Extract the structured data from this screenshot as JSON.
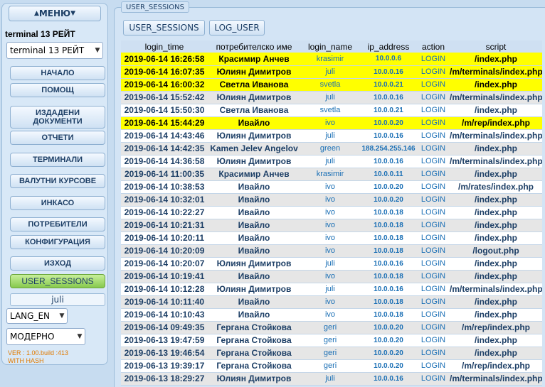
{
  "sidebar": {
    "menu_label": "МЕНЮ",
    "terminal_label": "terminal 13 РЕЙТ",
    "terminal_select": "terminal 13 РЕЙТ",
    "nav": [
      {
        "label": "НАЧАЛО"
      },
      {
        "label": "ПОМОЩ"
      },
      {
        "label": "ИЗДАДЕНИ ДОКУМЕНТИ"
      },
      {
        "label": "ОТЧЕТИ"
      },
      {
        "label": "ТЕРМИНАЛИ"
      },
      {
        "label": "ВАЛУТНИ КУРСОВЕ"
      },
      {
        "label": "ИНКАСО"
      },
      {
        "label": "ПОТРЕБИТЕЛИ"
      },
      {
        "label": "КОНФИГУРАЦИЯ"
      },
      {
        "label": "ИЗХОД"
      },
      {
        "label": "USER_SESSIONS"
      }
    ],
    "user": "juli",
    "lang": "LANG_EN",
    "theme": "МОДЕРНО",
    "version_line1": "VER : 1.00.build :413",
    "version_line2": "WITH HASH"
  },
  "main": {
    "legend": "USER_SESSIONS",
    "tabs": [
      {
        "label": "USER_SESSIONS"
      },
      {
        "label": "LOG_USER"
      }
    ],
    "columns": [
      "login_time",
      "потребителско име",
      "login_name",
      "ip_address",
      "action",
      "script"
    ],
    "rows": [
      {
        "time": "2019-06-14 16:26:58",
        "user": "Красимир Анчев",
        "login": "krasimir",
        "ip": "10.0.0.6",
        "action": "LOGIN",
        "script": "/index.php",
        "highlight": true
      },
      {
        "time": "2019-06-14 16:07:35",
        "user": "Юлиян Димитров",
        "login": "juli",
        "ip": "10.0.0.16",
        "action": "LOGIN",
        "script": "/m/terminals/index.php",
        "highlight": true
      },
      {
        "time": "2019-06-14 16:00:32",
        "user": "Светла Иванова",
        "login": "svetla",
        "ip": "10.0.0.21",
        "action": "LOGIN",
        "script": "/index.php",
        "highlight": true
      },
      {
        "time": "2019-06-14 15:52:42",
        "user": "Юлиян Димитров",
        "login": "juli",
        "ip": "10.0.0.16",
        "action": "LOGIN",
        "script": "/m/terminals/index.php",
        "highlight": false
      },
      {
        "time": "2019-06-14 15:50:30",
        "user": "Светла Иванова",
        "login": "svetla",
        "ip": "10.0.0.21",
        "action": "LOGIN",
        "script": "/index.php",
        "highlight": false
      },
      {
        "time": "2019-06-14 15:44:29",
        "user": "Ивайло",
        "login": "ivo",
        "ip": "10.0.0.20",
        "action": "LOGIN",
        "script": "/m/rep/index.php",
        "highlight": true
      },
      {
        "time": "2019-06-14 14:43:46",
        "user": "Юлиян Димитров",
        "login": "juli",
        "ip": "10.0.0.16",
        "action": "LOGIN",
        "script": "/m/terminals/index.php",
        "highlight": false
      },
      {
        "time": "2019-06-14 14:42:35",
        "user": "Kamen Jelev Angelov",
        "login": "green",
        "ip": "188.254.255.146",
        "action": "LOGIN",
        "script": "/index.php",
        "highlight": false
      },
      {
        "time": "2019-06-14 14:36:58",
        "user": "Юлиян Димитров",
        "login": "juli",
        "ip": "10.0.0.16",
        "action": "LOGIN",
        "script": "/m/terminals/index.php",
        "highlight": false
      },
      {
        "time": "2019-06-14 11:00:35",
        "user": "Красимир Анчев",
        "login": "krasimir",
        "ip": "10.0.0.11",
        "action": "LOGIN",
        "script": "/index.php",
        "highlight": false
      },
      {
        "time": "2019-06-14 10:38:53",
        "user": "Ивайло",
        "login": "ivo",
        "ip": "10.0.0.20",
        "action": "LOGIN",
        "script": "/m/rates/index.php",
        "highlight": false
      },
      {
        "time": "2019-06-14 10:32:01",
        "user": "Ивайло",
        "login": "ivo",
        "ip": "10.0.0.20",
        "action": "LOGIN",
        "script": "/index.php",
        "highlight": false
      },
      {
        "time": "2019-06-14 10:22:27",
        "user": "Ивайло",
        "login": "ivo",
        "ip": "10.0.0.18",
        "action": "LOGIN",
        "script": "/index.php",
        "highlight": false
      },
      {
        "time": "2019-06-14 10:21:31",
        "user": "Ивайло",
        "login": "ivo",
        "ip": "10.0.0.18",
        "action": "LOGIN",
        "script": "/index.php",
        "highlight": false
      },
      {
        "time": "2019-06-14 10:20:11",
        "user": "Ивайло",
        "login": "ivo",
        "ip": "10.0.0.18",
        "action": "LOGIN",
        "script": "/index.php",
        "highlight": false
      },
      {
        "time": "2019-06-14 10:20:09",
        "user": "Ивайло",
        "login": "ivo",
        "ip": "10.0.0.18",
        "action": "LOGIN",
        "script": "/logout.php",
        "highlight": false
      },
      {
        "time": "2019-06-14 10:20:07",
        "user": "Юлиян Димитров",
        "login": "juli",
        "ip": "10.0.0.16",
        "action": "LOGIN",
        "script": "/index.php",
        "highlight": false
      },
      {
        "time": "2019-06-14 10:19:41",
        "user": "Ивайло",
        "login": "ivo",
        "ip": "10.0.0.18",
        "action": "LOGIN",
        "script": "/index.php",
        "highlight": false
      },
      {
        "time": "2019-06-14 10:12:28",
        "user": "Юлиян Димитров",
        "login": "juli",
        "ip": "10.0.0.16",
        "action": "LOGIN",
        "script": "/m/terminals/index.php",
        "highlight": false
      },
      {
        "time": "2019-06-14 10:11:40",
        "user": "Ивайло",
        "login": "ivo",
        "ip": "10.0.0.18",
        "action": "LOGIN",
        "script": "/index.php",
        "highlight": false
      },
      {
        "time": "2019-06-14 10:10:43",
        "user": "Ивайло",
        "login": "ivo",
        "ip": "10.0.0.18",
        "action": "LOGIN",
        "script": "/index.php",
        "highlight": false
      },
      {
        "time": "2019-06-14 09:49:35",
        "user": "Гергана Стойкова",
        "login": "geri",
        "ip": "10.0.0.20",
        "action": "LOGIN",
        "script": "/m/rep/index.php",
        "highlight": false
      },
      {
        "time": "2019-06-13 19:47:59",
        "user": "Гергана Стойкова",
        "login": "geri",
        "ip": "10.0.0.20",
        "action": "LOGIN",
        "script": "/index.php",
        "highlight": false
      },
      {
        "time": "2019-06-13 19:46:54",
        "user": "Гергана Стойкова",
        "login": "geri",
        "ip": "10.0.0.20",
        "action": "LOGIN",
        "script": "/index.php",
        "highlight": false
      },
      {
        "time": "2019-06-13 19:39:17",
        "user": "Гергана Стойкова",
        "login": "geri",
        "ip": "10.0.0.20",
        "action": "LOGIN",
        "script": "/m/rep/index.php",
        "highlight": false
      },
      {
        "time": "2019-06-13 18:29:27",
        "user": "Юлиян Димитров",
        "login": "juli",
        "ip": "10.0.0.16",
        "action": "LOGIN",
        "script": "/m/terminals/index.php",
        "highlight": false
      }
    ]
  },
  "colors": {
    "highlight_row": "#ffff00",
    "alt_row": "#e6e6e6",
    "active_nav": "#86c94e",
    "link_blue": "#1a6fb5",
    "text_navy": "#1d3f66",
    "version_orange": "#e07a00"
  }
}
